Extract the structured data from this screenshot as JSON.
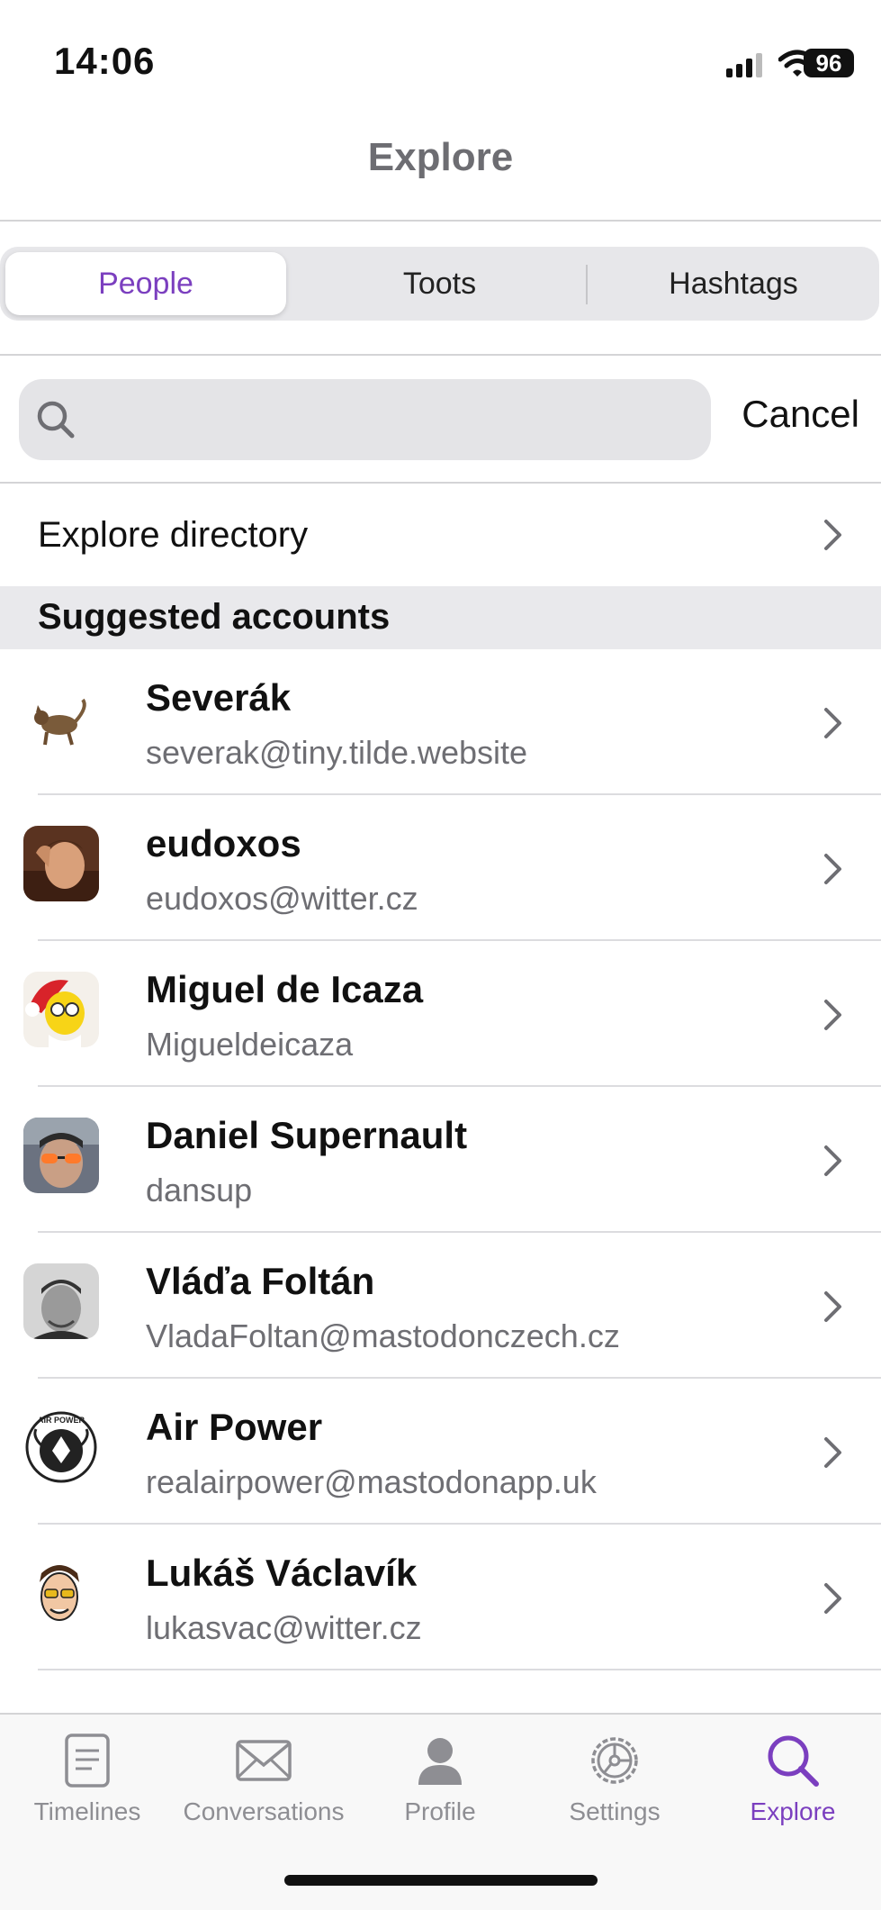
{
  "status_bar": {
    "time": "14:06",
    "battery": "96"
  },
  "nav": {
    "title": "Explore"
  },
  "segments": [
    {
      "label": "People",
      "selected": true
    },
    {
      "label": "Toots",
      "selected": false
    },
    {
      "label": "Hashtags",
      "selected": false
    }
  ],
  "search": {
    "value": "",
    "placeholder": "",
    "cancel_label": "Cancel"
  },
  "directory": {
    "label": "Explore directory"
  },
  "section": {
    "title": "Suggested accounts"
  },
  "accounts": [
    {
      "name": "Severák",
      "handle": "severak@tiny.tilde.website"
    },
    {
      "name": "eudoxos",
      "handle": "eudoxos@witter.cz"
    },
    {
      "name": "Miguel de Icaza",
      "handle": "Migueldeicaza"
    },
    {
      "name": "Daniel Supernault",
      "handle": "dansup"
    },
    {
      "name": "Vláďa Foltán",
      "handle": "VladaFoltan@mastodonczech.cz"
    },
    {
      "name": "Air Power",
      "handle": "realairpower@mastodonapp.uk"
    },
    {
      "name": "Lukáš Václavík",
      "handle": "lukasvac@witter.cz"
    }
  ],
  "tabs": [
    {
      "label": "Timelines",
      "icon": "document-icon"
    },
    {
      "label": "Conversations",
      "icon": "envelope-icon"
    },
    {
      "label": "Profile",
      "icon": "person-icon"
    },
    {
      "label": "Settings",
      "icon": "gear-icon"
    },
    {
      "label": "Explore",
      "icon": "search-icon",
      "active": true
    }
  ],
  "colors": {
    "accent": "#7b3fbf",
    "secondary_text": "#6e6e73",
    "section_bg": "#e9e9ec"
  }
}
